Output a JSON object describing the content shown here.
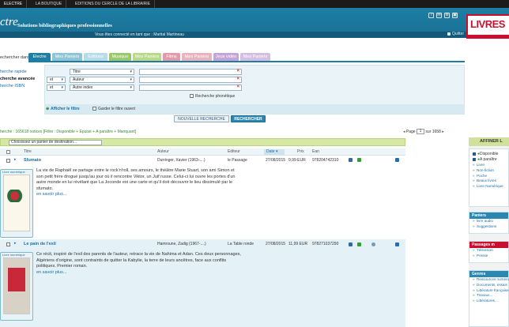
{
  "topnav": [
    {
      "label": "Electre",
      "active": true
    },
    {
      "label": "La boutique",
      "active": false
    },
    {
      "label": "Editions du Cercle de la Librairie",
      "active": false
    }
  ],
  "header": {
    "logo": "ctre",
    "tagline": "Solutions bibliographiques professionnelles",
    "user_message": "Vous êtes connecté en tant que : Martial Martineau",
    "quit": "Quitter",
    "brand": "LIVRES"
  },
  "search": {
    "label": "echercher dans :",
    "tabs": [
      {
        "label": "Electre",
        "color": "#1d7ea4"
      },
      {
        "label": "Mes Paniers",
        "color": "#8ec5d6"
      },
      {
        "label": "Editions",
        "color": "#b7dce8"
      },
      {
        "label": "Musique",
        "color": "#9ac96a"
      },
      {
        "label": "Mes Paniers",
        "color": "#b9d88a"
      },
      {
        "label": "Films",
        "color": "#e49aaa"
      },
      {
        "label": "Mes Paniers",
        "color": "#e9b2bf"
      },
      {
        "label": "Jeux vidéo",
        "color": "#c4a5d8"
      },
      {
        "label": "Mes Paniers",
        "color": "#d5bde3"
      }
    ],
    "modes": [
      {
        "label": "herche rapide",
        "active": false
      },
      {
        "label": "cherche avancée",
        "active": true
      },
      {
        "label": "herche ISBN",
        "active": false
      }
    ],
    "criteria": [
      {
        "op": "",
        "field": "Titre"
      },
      {
        "op": "et",
        "field": "Auteur"
      },
      {
        "op": "et",
        "field": "Autre index"
      }
    ],
    "phonetic": "Recherche phonétique",
    "show_filter": "Afficher le filtre",
    "keep_filter": "Garder le filtre ouvert",
    "new_search": "NOUVELLE RECHERCHE",
    "search_button": "RECHERCHER"
  },
  "results": {
    "summary": "herche : 165618 notices",
    "filter_info": "[Filtre : Disponible + Epuisé + A paraître + Manquant]",
    "page_label": "Page",
    "page_value": "1",
    "page_total": "sur 1658",
    "destination_placeholder": "Choisissez un panier de destination...",
    "columns": [
      "Titre",
      "Auteur",
      "Editeur",
      "Date",
      "Prix",
      "Ean"
    ],
    "items": [
      {
        "title": "Sfumato",
        "author": "Durringer, Xavier (1963-....)",
        "publisher": "le Passage",
        "date": "27/08/2015",
        "price": "9,99 EUR",
        "ean": "978204742310",
        "description": "La vie de Raphaël se partage entre le rock'n'roll, ses amours, le théâtre Marie Stuart, son ami Simon et son petit frère drogué jusqu'au jour où il rencontre Viktor, un Juif russe. Celui-ci lui ouvre les portes d'un autre monde en lui révélant que La Joconde est une carte et qu'il doit découvrir le lieu dissimulé par le sfumato.",
        "more": "en savoir plus...",
        "cover_caption": "Livre numérique"
      },
      {
        "title": "Le pain de l'exil",
        "author": "Hamroune, Zadig (1967-....)",
        "publisher": "La Table ronde",
        "date": "27/08/2015",
        "price": "11,99 EUR",
        "ean": "978271037290",
        "description": "Ce récit, inspiré de l'exil des parents de l'auteur, retrace la vie de Nahima et Adan. Ces deux personnages, Algériens d'origine, sont contraints de quitter la Kabylie, la terre de leurs ancêtres, face aux conflits politiques. Premier roman.",
        "more": "en savoir plus...",
        "cover_caption": "Livre numérique"
      }
    ]
  },
  "sidebar": {
    "title": "AFFINER L",
    "checks": [
      "Disponible",
      "A paraître"
    ],
    "formats": [
      "Livre",
      "Non-fiction",
      "Poche",
      "Beaux livres",
      "Livre Numérique"
    ],
    "paniers_title": "Paniers",
    "paniers": [
      "livre audio",
      "Suggestions"
    ],
    "passages_title": "Passages m",
    "passages": [
      "Télévision",
      "Presse"
    ],
    "genres_title": "Genres",
    "genres": [
      "Ressources numériques",
      "Documents, essais",
      "Littérature française",
      "Travaux...",
      "Littératures..."
    ]
  },
  "colors": {
    "header_blue": "#1d7ea4",
    "link_blue": "#1a6fa8",
    "brand_red": "#c8102e",
    "green_bar": "#d6e9a4"
  }
}
